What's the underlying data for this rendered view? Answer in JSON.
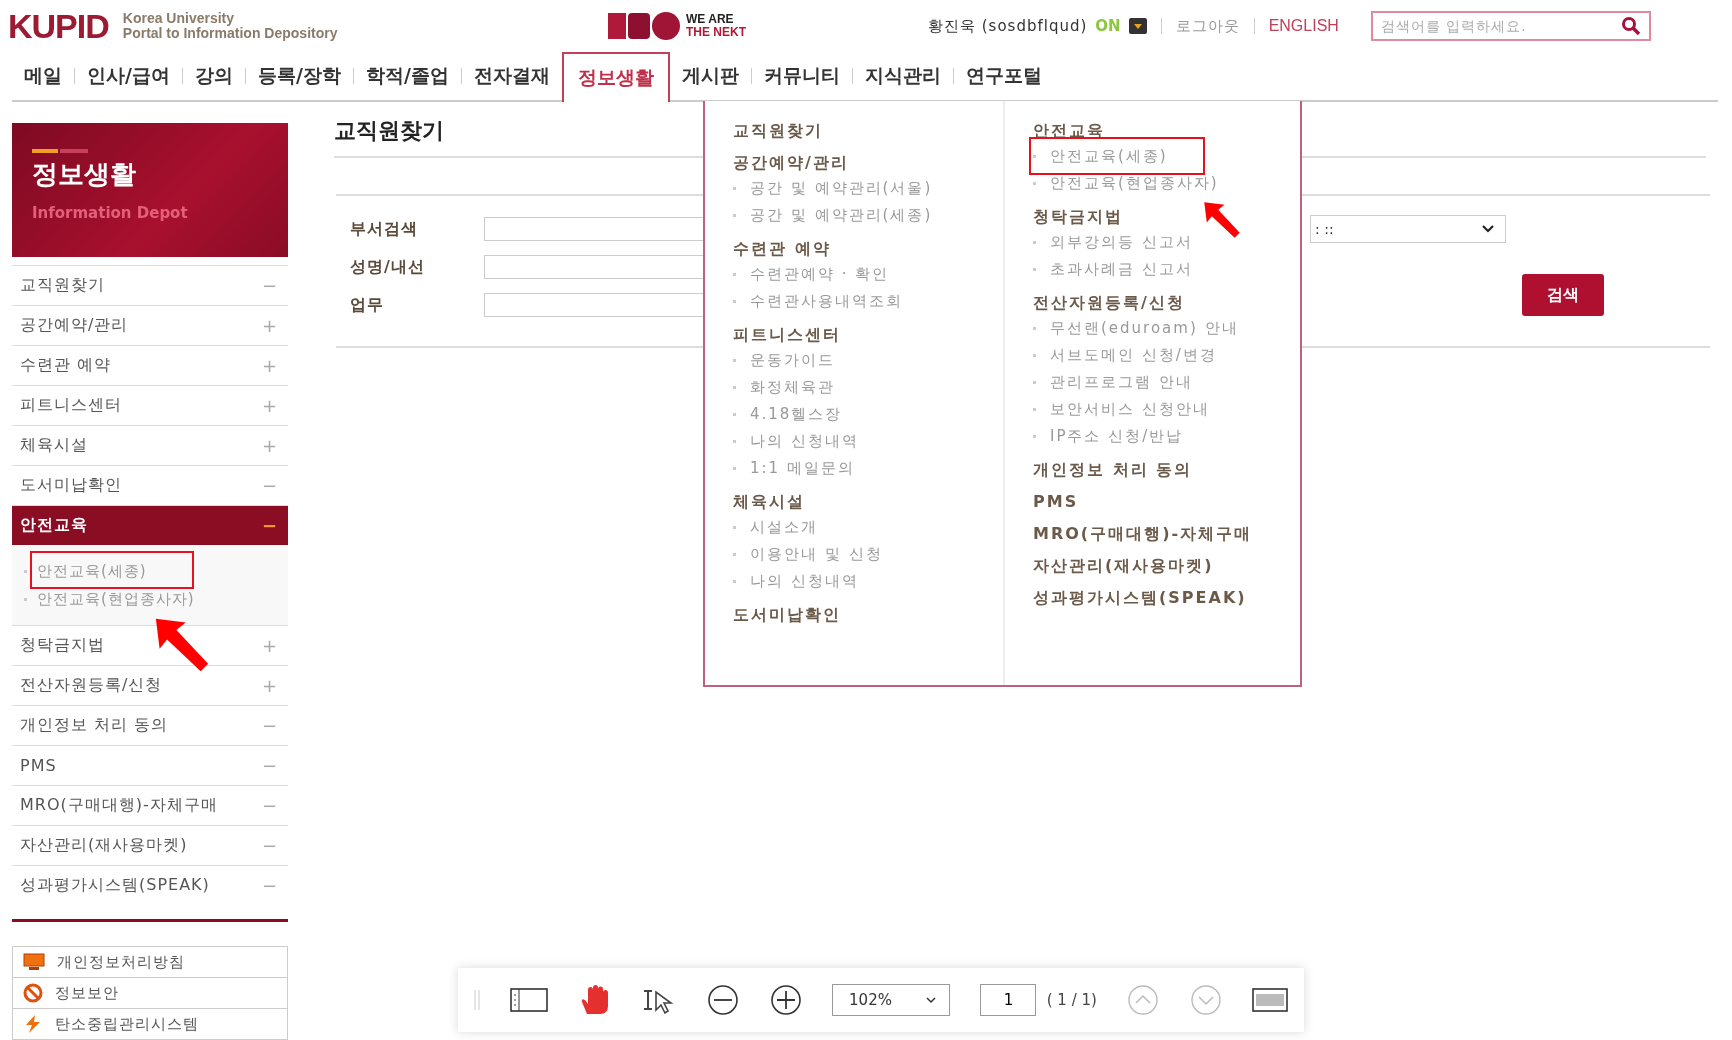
{
  "header": {
    "logo": "KUPID",
    "logo_sub": [
      "Korea University",
      "Portal to Information Depository"
    ],
    "emblem": [
      "WE ARE",
      "THE NEKT"
    ],
    "user": "황진욱 (sosdbflqud)",
    "status": "ON",
    "logout": "로그아웃",
    "language": "ENGLISH",
    "search": {
      "placeholder": "검색어를 입력하세요."
    }
  },
  "nav": [
    {
      "label": "메일",
      "selected": false
    },
    {
      "label": "인사/급여",
      "selected": false
    },
    {
      "label": "강의",
      "selected": false
    },
    {
      "label": "등록/장학",
      "selected": false
    },
    {
      "label": "학적/졸업",
      "selected": false
    },
    {
      "label": "전자결재",
      "selected": false
    },
    {
      "label": "정보생활",
      "selected": true
    },
    {
      "label": "게시판",
      "selected": false
    },
    {
      "label": "커뮤니티",
      "selected": false
    },
    {
      "label": "지식관리",
      "selected": false
    },
    {
      "label": "연구포털",
      "selected": false
    }
  ],
  "sidebar": {
    "title": "정보생활",
    "subtitle": "Information Depot",
    "items": [
      {
        "label": "교직원찾기",
        "sign": "−",
        "selected": false
      },
      {
        "label": "공간예약/관리",
        "sign": "+",
        "selected": false
      },
      {
        "label": "수련관 예약",
        "sign": "+",
        "selected": false
      },
      {
        "label": "피트니스센터",
        "sign": "+",
        "selected": false
      },
      {
        "label": "체육시설",
        "sign": "+",
        "selected": false
      },
      {
        "label": "도서미납확인",
        "sign": "−",
        "selected": false
      },
      {
        "label": "안전교육",
        "sign": "−",
        "selected": true,
        "children": [
          {
            "label": "안전교육(세종)",
            "highlighted": true
          },
          {
            "label": "안전교육(현업종사자)",
            "highlighted": false
          }
        ]
      },
      {
        "label": "청탁금지법",
        "sign": "+",
        "selected": false
      },
      {
        "label": "전산자원등록/신청",
        "sign": "+",
        "selected": false
      },
      {
        "label": "개인정보 처리 동의",
        "sign": "−",
        "selected": false
      },
      {
        "label": "PMS",
        "sign": "−",
        "selected": false
      },
      {
        "label": "MRO(구매대행)-자체구매",
        "sign": "−",
        "selected": false
      },
      {
        "label": "자산관리(재사용마켓)",
        "sign": "−",
        "selected": false
      },
      {
        "label": "성과평가시스템(SPEAK)",
        "sign": "−",
        "selected": false
      }
    ],
    "links": [
      {
        "label": "개인정보처리방침",
        "kind": "monitor"
      },
      {
        "label": "정보보안",
        "kind": "prohibit"
      },
      {
        "label": "탄소중립관리시스템",
        "kind": "bolt"
      }
    ]
  },
  "content": {
    "title": "교직원찾기",
    "fields": [
      {
        "label": "부서검색"
      },
      {
        "label": "성명/내선"
      },
      {
        "label": "업무"
      }
    ],
    "select": ": ::",
    "search_button": "검색"
  },
  "menu": {
    "columns": [
      [
        {
          "heading": "교직원찾기"
        },
        {
          "heading": "공간예약/관리",
          "items": [
            "공간 및 예약관리(서울)",
            "공간 및 예약관리(세종)"
          ]
        },
        {
          "heading": "수련관 예약",
          "items": [
            "수련관예약 · 확인",
            "수련관사용내역조회"
          ]
        },
        {
          "heading": "피트니스센터",
          "items": [
            "운동가이드",
            "화정체육관",
            "4.18헬스장",
            "나의 신청내역",
            "1:1 메일문의"
          ]
        },
        {
          "heading": "체육시설",
          "items": [
            "시설소개",
            "이용안내 및 신청",
            "나의 신청내역"
          ]
        },
        {
          "heading": "도서미납확인"
        }
      ],
      [
        {
          "heading": "안전교육",
          "items": [
            "안전교육(세종)",
            "안전교육(현업종사자)"
          ],
          "highlighted": [
            true,
            false
          ]
        },
        {
          "heading": "청탁금지법",
          "items": [
            "외부강의등 신고서",
            "초과사례금 신고서"
          ]
        },
        {
          "heading": "전산자원등록/신청",
          "items": [
            "무선랜(eduroam) 안내",
            "서브도메인 신청/변경",
            "관리프로그램 안내",
            "보안서비스 신청안내",
            "IP주소 신청/반납"
          ]
        },
        {
          "heading": "개인정보 처리 동의"
        },
        {
          "heading": "PMS"
        },
        {
          "heading": "MRO(구매대행)-자체구매"
        },
        {
          "heading": "자산관리(재사용마켓)"
        },
        {
          "heading": "성과평가시스템(SPEAK)"
        }
      ]
    ]
  },
  "viewer_toolbar": {
    "zoom": "102%",
    "page": "1",
    "page_count": "( 1 / 1)"
  }
}
